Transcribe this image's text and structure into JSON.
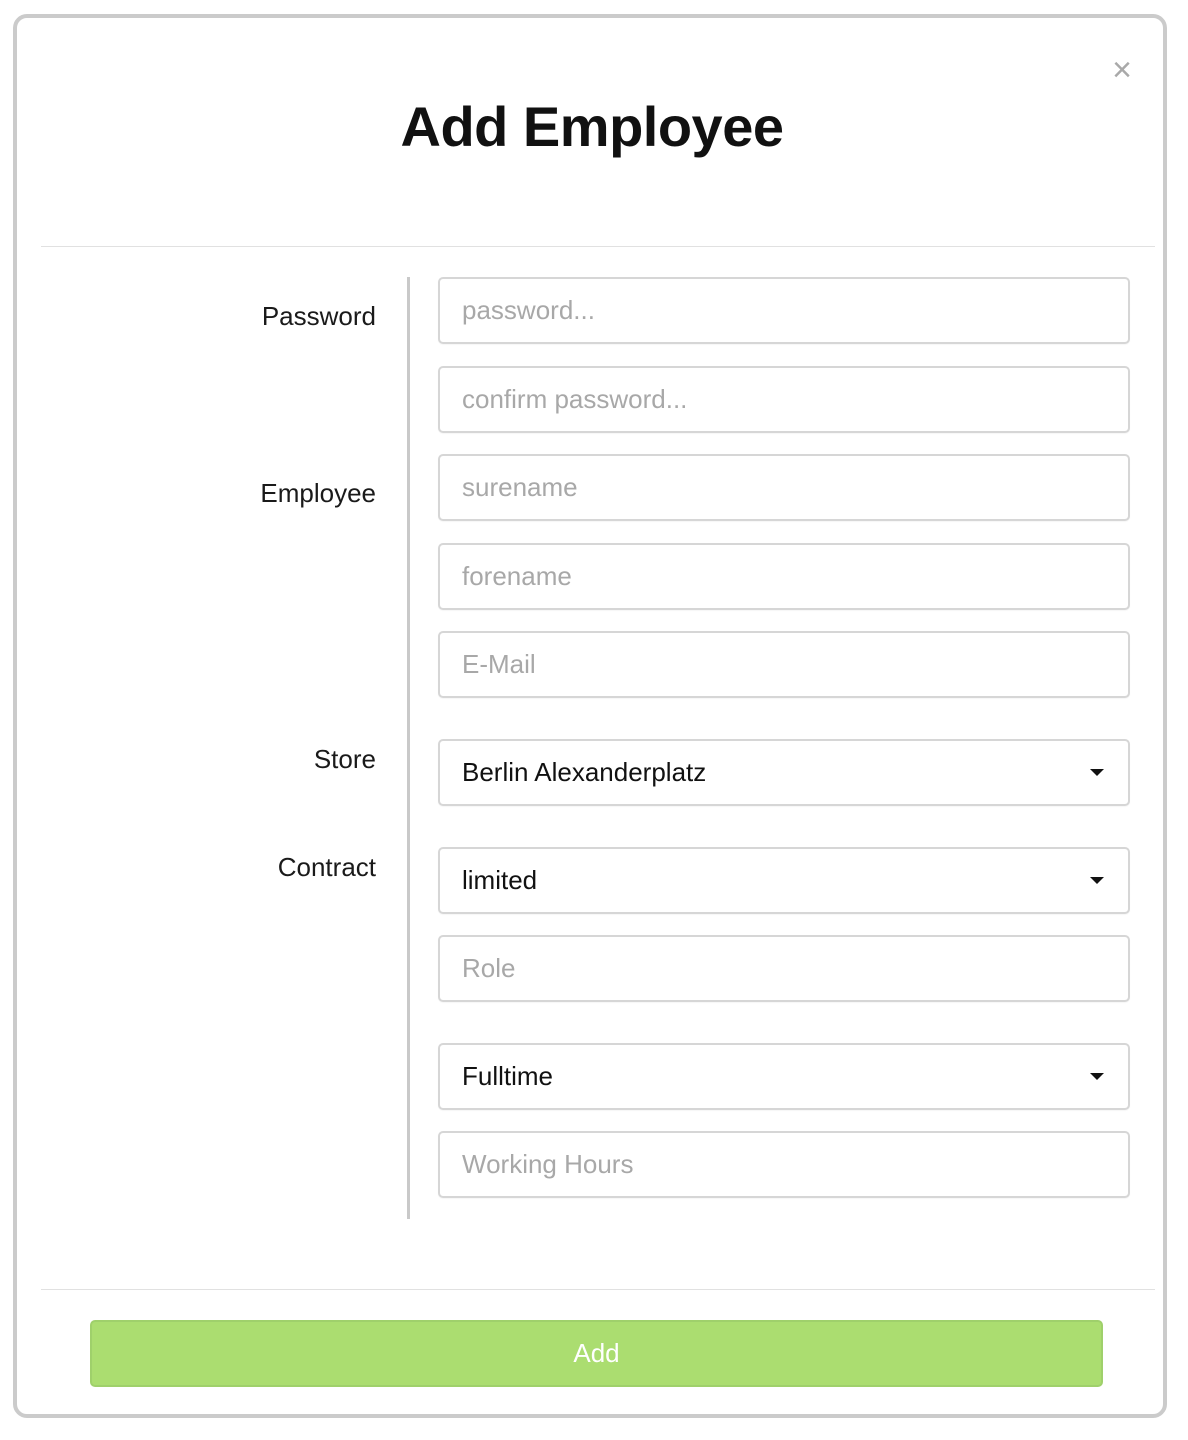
{
  "dialog": {
    "title": "Add Employee",
    "close_symbol": "×"
  },
  "labels": {
    "password": "Password",
    "employee": "Employee",
    "store": "Store",
    "contract": "Contract"
  },
  "fields": {
    "password": {
      "placeholder": "password...",
      "value": ""
    },
    "confirm_password": {
      "placeholder": "confirm password...",
      "value": ""
    },
    "surename": {
      "placeholder": "surename",
      "value": ""
    },
    "forename": {
      "placeholder": "forename",
      "value": ""
    },
    "email": {
      "placeholder": "E-Mail",
      "value": ""
    },
    "store": {
      "selected": "Berlin Alexanderplatz"
    },
    "contract_type": {
      "selected": "limited"
    },
    "role": {
      "placeholder": "Role",
      "value": ""
    },
    "employment": {
      "selected": "Fulltime"
    },
    "working_hours": {
      "placeholder": "Working Hours",
      "value": ""
    }
  },
  "actions": {
    "add_label": "Add"
  },
  "icons": {
    "close": "close-icon",
    "dropdown": "caret-down-icon"
  },
  "colors": {
    "add_button": "#abdd70",
    "border": "#d6d6d6"
  }
}
